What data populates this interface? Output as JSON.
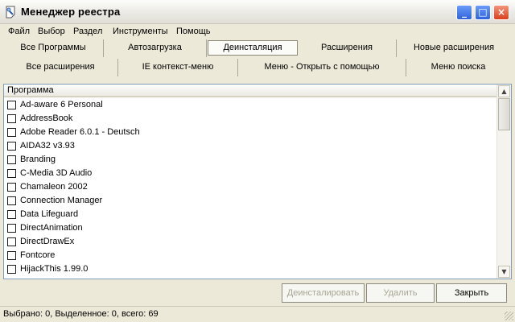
{
  "window": {
    "title": "Менеджер реестра",
    "controls": {
      "minimize": "_",
      "maximize": "□",
      "close": "×"
    }
  },
  "menu": [
    "Файл",
    "Выбор",
    "Раздел",
    "Инструменты",
    "Помощь"
  ],
  "tabs_row1": [
    {
      "label": "Все Программы",
      "active": false
    },
    {
      "label": "Автозагрузка",
      "active": false
    },
    {
      "label": "Деинсталяция",
      "active": true
    },
    {
      "label": "Расширения",
      "active": false
    },
    {
      "label": "Новые расширения",
      "active": false
    }
  ],
  "tabs_row2": [
    {
      "label": "Все расширения"
    },
    {
      "label": "IE контекст-меню"
    },
    {
      "label": "Меню - Открыть с помощью"
    },
    {
      "label": "Меню поиска"
    }
  ],
  "list": {
    "column_header": "Программа",
    "items": [
      "Ad-aware 6 Personal",
      "AddressBook",
      "Adobe Reader 6.0.1 - Deutsch",
      "AIDA32 v3.93",
      "Branding",
      "C-Media 3D Audio",
      "Chamaleon 2002",
      "Connection Manager",
      "Data Lifeguard",
      "DirectAnimation",
      "DirectDrawEx",
      "Fontcore",
      "HijackThis 1.99.0"
    ]
  },
  "buttons": {
    "uninstall": "Деинсталировать",
    "delete": "Удалить",
    "close": "Закрыть"
  },
  "status": "Выбрано: 0, Выделенное: 0, всего: 69"
}
